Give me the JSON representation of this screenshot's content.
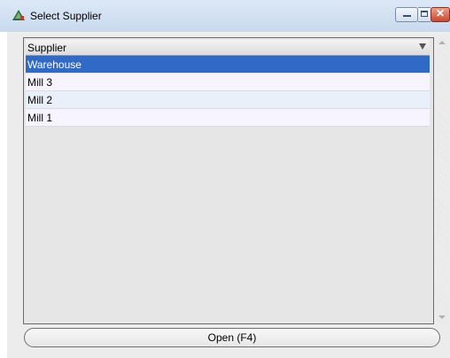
{
  "window": {
    "title": "Select Supplier"
  },
  "grid": {
    "column_header": "Supplier",
    "rows": [
      "Warehouse",
      "Mill 3",
      "Mill 2",
      "Mill 1"
    ],
    "selected_index": 0
  },
  "buttons": {
    "open_label": "Open (F4)"
  },
  "colors": {
    "selection": "#3169c6",
    "row_alt_1": "#f7f3ff",
    "row_alt_2": "#e9f0f9"
  }
}
